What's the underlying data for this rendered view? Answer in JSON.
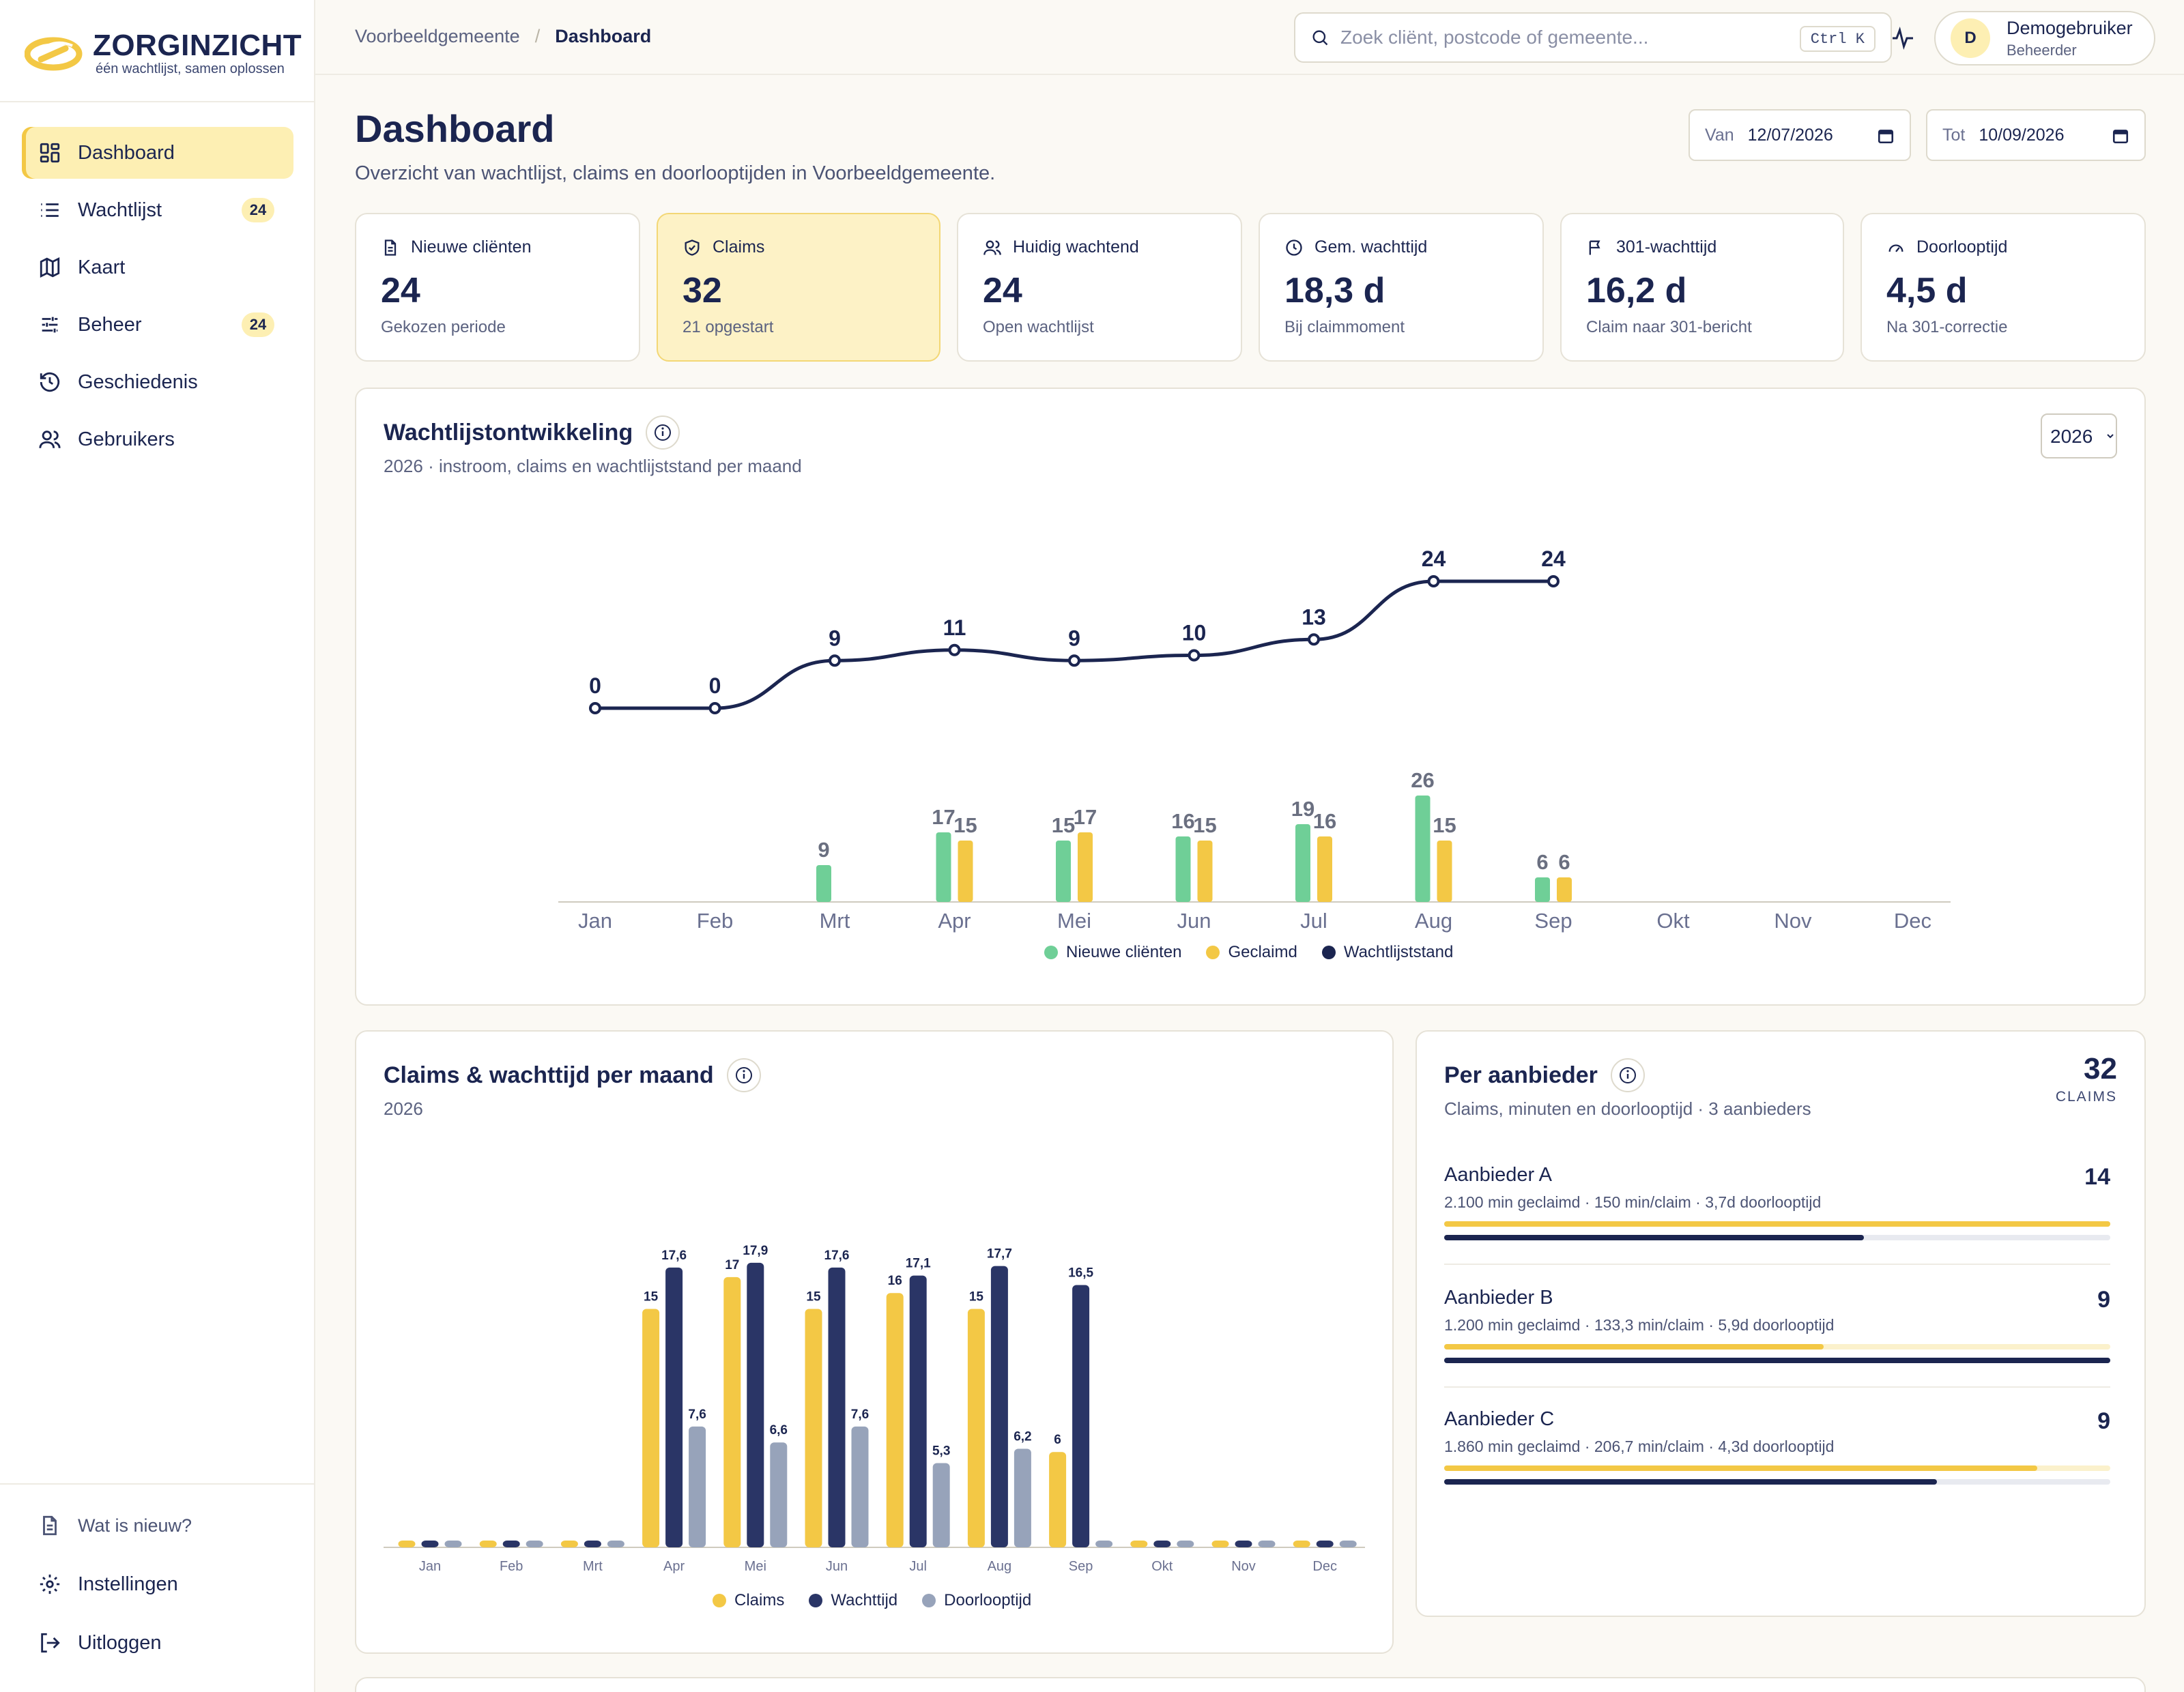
{
  "brand": {
    "name": "ZORGINZICHT",
    "tagline": "één wachtlijst, samen oplossen",
    "accent": "#f3c845",
    "navy": "#1b2550",
    "green": "#6fcf97"
  },
  "sidebar": {
    "items": [
      {
        "label": "Dashboard",
        "icon": "grid-icon",
        "active": true
      },
      {
        "label": "Wachtlijst",
        "icon": "list-icon",
        "badge": "24"
      },
      {
        "label": "Kaart",
        "icon": "map-icon"
      },
      {
        "label": "Beheer",
        "icon": "sliders-icon",
        "badge": "24"
      },
      {
        "label": "Geschiedenis",
        "icon": "history-icon"
      },
      {
        "label": "Gebruikers",
        "icon": "users-icon"
      }
    ],
    "bottom": [
      {
        "label": "Wat is nieuw?",
        "icon": "document-icon"
      },
      {
        "label": "Instellingen",
        "icon": "gear-icon"
      },
      {
        "label": "Uitloggen",
        "icon": "logout-icon"
      }
    ]
  },
  "topbar": {
    "breadcrumb": [
      "Voorbeeldgemeente",
      "Dashboard"
    ],
    "breadcrumb_sep": "/",
    "search_placeholder": "Zoek cliënt, postcode of gemeente...",
    "search_shortcut": "Ctrl K",
    "user": {
      "initial": "D",
      "name": "Demogebruiker",
      "role": "Beheerder"
    }
  },
  "header": {
    "title": "Dashboard",
    "subtitle": "Overzicht van wachtlijst, claims en doorlooptijden in Voorbeeldgemeente.",
    "from_label": "Van",
    "from_value": "12/07/2026",
    "to_label": "Tot",
    "to_value": "10/09/2026"
  },
  "kpis": [
    {
      "label": "Nieuwe cliënten",
      "value": "24",
      "sub": "Gekozen periode",
      "icon": "document-icon"
    },
    {
      "label": "Claims",
      "value": "32",
      "sub": "21 opgestart",
      "icon": "shield-check-icon",
      "highlight": true
    },
    {
      "label": "Huidig wachtend",
      "value": "24",
      "sub": "Open wachtlijst",
      "icon": "users-icon"
    },
    {
      "label": "Gem. wachttijd",
      "value": "18,3 d",
      "sub": "Bij claimmoment",
      "icon": "clock-icon"
    },
    {
      "label": "301-wachttijd",
      "value": "16,2 d",
      "sub": "Claim naar 301-bericht",
      "icon": "flag-icon"
    },
    {
      "label": "Doorlooptijd",
      "value": "4,5 d",
      "sub": "Na 301-correctie",
      "icon": "gauge-icon"
    }
  ],
  "panels": {
    "trend": {
      "title": "Wachtlijstontwikkeling",
      "subtitle": "2026 · instroom, claims en wachtlijststand per maand",
      "year": "2026"
    },
    "claims": {
      "title": "Claims & wachttijd per maand",
      "subtitle": "2026"
    },
    "providers": {
      "title": "Per aanbieder",
      "subtitle": "Claims, minuten en doorlooptijd · 3 aanbieders",
      "total": "32",
      "total_caption": "CLAIMS",
      "items": [
        {
          "name": "Aanbieder A",
          "detail": "2.100 min geclaimd · 150 min/claim · 3,7d doorlooptijd",
          "count": "14",
          "claims_share": 1.0,
          "lead_share": 0.63
        },
        {
          "name": "Aanbieder B",
          "detail": "1.200 min geclaimd · 133,3 min/claim · 5,9d doorlooptijd",
          "count": "9",
          "claims_share": 0.57,
          "lead_share": 1.0
        },
        {
          "name": "Aanbieder C",
          "detail": "1.860 min geclaimd · 206,7 min/claim · 4,3d doorlooptijd",
          "count": "9",
          "claims_share": 0.89,
          "lead_share": 0.74
        }
      ]
    }
  },
  "chart_data": [
    {
      "type": "bar",
      "title": "Wachtlijstontwikkeling",
      "categories": [
        "Jan",
        "Feb",
        "Mrt",
        "Apr",
        "Mei",
        "Jun",
        "Jul",
        "Aug",
        "Sep",
        "Okt",
        "Nov",
        "Dec"
      ],
      "series": [
        {
          "name": "Nieuwe cliënten",
          "type": "bar",
          "color": "#6fcf97",
          "values": [
            0,
            0,
            9,
            17,
            15,
            16,
            19,
            26,
            6,
            null,
            null,
            null
          ]
        },
        {
          "name": "Geclaimd",
          "type": "bar",
          "color": "#f3c845",
          "values": [
            0,
            0,
            0,
            15,
            17,
            15,
            16,
            15,
            6,
            null,
            null,
            null
          ]
        },
        {
          "name": "Wachtlijststand",
          "type": "line",
          "color": "#1b2550",
          "values": [
            0,
            0,
            9,
            11,
            9,
            10,
            13,
            24,
            24,
            null,
            null,
            null
          ]
        }
      ],
      "grid": false,
      "legend": "bottom"
    },
    {
      "type": "bar",
      "title": "Claims & wachttijd per maand",
      "categories": [
        "Jan",
        "Feb",
        "Mrt",
        "Apr",
        "Mei",
        "Jun",
        "Jul",
        "Aug",
        "Sep",
        "Okt",
        "Nov",
        "Dec"
      ],
      "series": [
        {
          "name": "Claims",
          "color": "#f3c845",
          "values": [
            0,
            0,
            0,
            15,
            17,
            15,
            16,
            15,
            6,
            0,
            0,
            0
          ]
        },
        {
          "name": "Wachttijd",
          "color": "#2a3566",
          "values": [
            0,
            0,
            0,
            17.6,
            17.9,
            17.6,
            17.1,
            17.7,
            16.5,
            0,
            0,
            0
          ]
        },
        {
          "name": "Doorlooptijd",
          "color": "#97a3ba",
          "values": [
            0,
            0,
            0,
            7.6,
            6.6,
            7.6,
            5.3,
            6.2,
            0,
            0,
            0,
            0
          ]
        }
      ],
      "labels": [
        [
          null,
          null,
          null,
          "15",
          "17",
          "15",
          "16",
          "15",
          "6",
          null,
          null,
          null
        ],
        [
          null,
          null,
          null,
          "17,6",
          "17,9",
          "17,6",
          "17,1",
          "17,7",
          "16,5",
          null,
          null,
          null
        ],
        [
          null,
          null,
          null,
          "7,6",
          "6,6",
          "7,6",
          "5,3",
          "6,2",
          null,
          null,
          null,
          null
        ]
      ],
      "grid": false,
      "legend": "bottom"
    }
  ]
}
